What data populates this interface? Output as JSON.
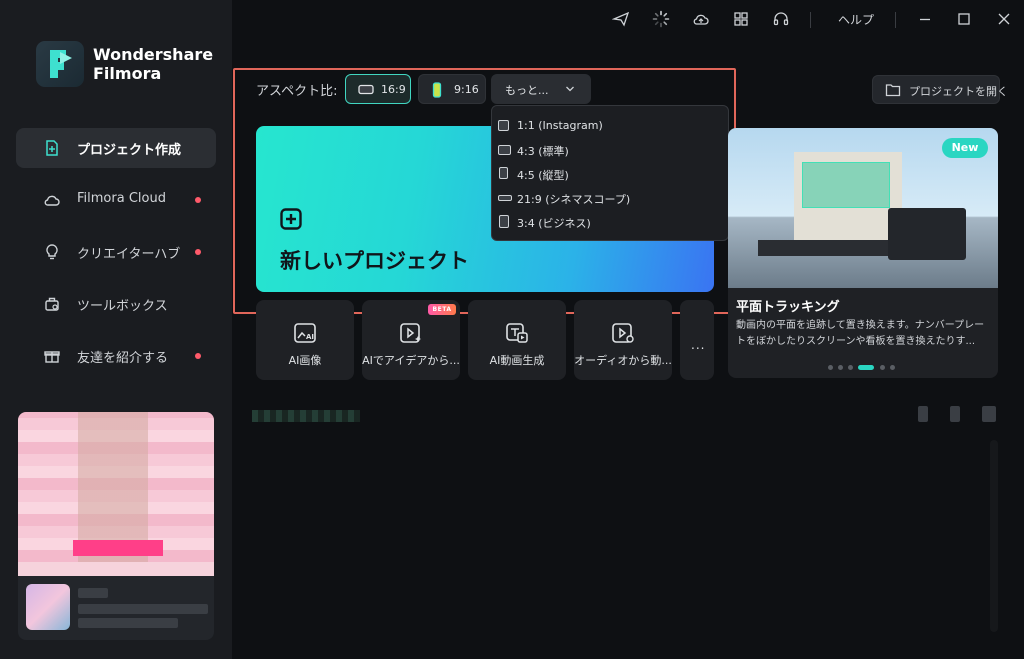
{
  "app": {
    "brand_line1": "Wondershare",
    "brand_line2": "Filmora"
  },
  "sidebar": {
    "items": [
      {
        "label": "プロジェクト作成",
        "icon": "new-project-icon",
        "active": true,
        "dot": false
      },
      {
        "label": "Filmora Cloud",
        "icon": "cloud-icon",
        "active": false,
        "dot": true
      },
      {
        "label": "クリエイターハブ",
        "icon": "lightbulb-icon",
        "active": false,
        "dot": true
      },
      {
        "label": "ツールボックス",
        "icon": "toolbox-icon",
        "active": false,
        "dot": false
      },
      {
        "label": "友達を紹介する",
        "icon": "gift-icon",
        "active": false,
        "dot": true
      }
    ]
  },
  "titlebar": {
    "help_label": "ヘルプ",
    "icons": [
      "send-icon",
      "loading-spinner-icon",
      "cloud-upload-icon",
      "apps-grid-icon",
      "headset-icon",
      "minimize-icon",
      "maximize-icon",
      "close-icon"
    ]
  },
  "aspect": {
    "label": "アスペクト比:",
    "options": [
      {
        "label": "16:9",
        "selected": true
      },
      {
        "label": "9:16",
        "selected": false
      }
    ],
    "more_label": "もっと...",
    "dropdown": [
      "1:1 (Instagram)",
      "4:3 (標準)",
      "4:5 (縦型)",
      "21:9 (シネマスコープ)",
      "3:4 (ビジネス)"
    ]
  },
  "open_project_label": "プロジェクトを開く",
  "new_project_label": "新しいプロジェクト",
  "tools": [
    {
      "label": "AI画像",
      "icon": "ai-image-icon"
    },
    {
      "label": "AIでアイデアから...",
      "icon": "ai-idea-icon",
      "badge": "BETA"
    },
    {
      "label": "AI動画生成",
      "icon": "ai-video-icon"
    },
    {
      "label": "オーディオから動...",
      "icon": "audio-to-video-icon"
    }
  ],
  "tools_more_label": "...",
  "feature": {
    "badge": "New",
    "title": "平面トラッキング",
    "description": "動画内の平面を追跡して置き換えます。ナンバープレートをぼかしたりスクリーンや看板を置き換えたりす...",
    "pager_count": 6,
    "pager_active": 3
  },
  "colors": {
    "accent": "#2ad6c2",
    "highlight": "#e0665a",
    "notify_dot": "#ff5a6a"
  }
}
